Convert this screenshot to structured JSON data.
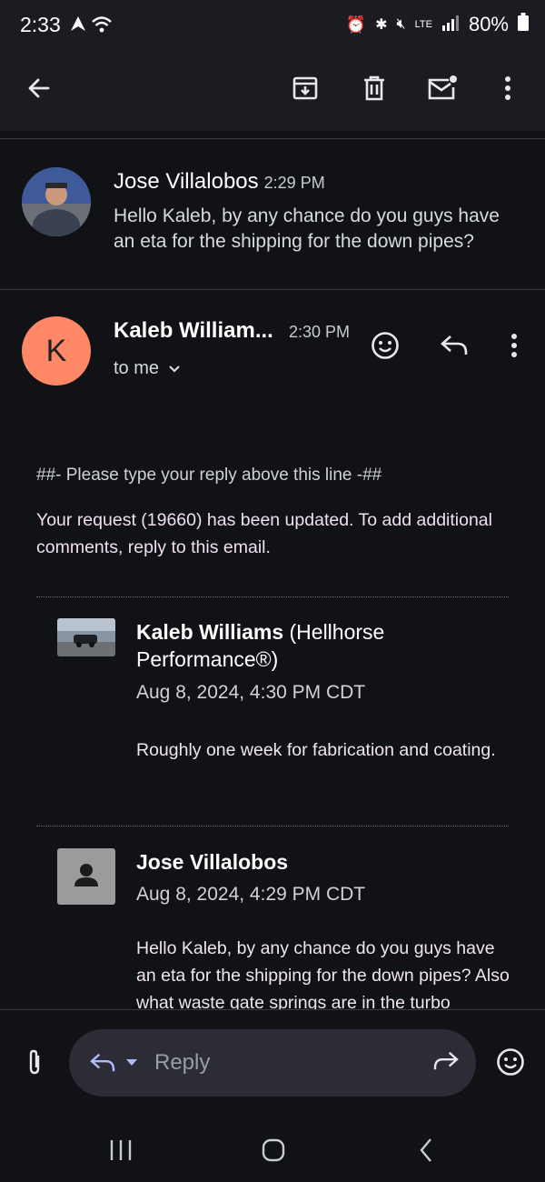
{
  "status_bar": {
    "time": "2:33",
    "battery": "80%",
    "network": "LTE"
  },
  "toolbar": {
    "back_icon": "arrow-back-icon",
    "archive_icon": "archive-icon",
    "delete_icon": "trash-icon",
    "mark_unread_icon": "mail-unread-icon",
    "more_icon": "more-vertical-icon"
  },
  "message1": {
    "sender": "Jose Villalobos",
    "time": "2:29 PM",
    "preview": "Hello Kaleb, by any chance do you guys have an eta for the shipping for the down pipes?"
  },
  "message2": {
    "avatar_letter": "K",
    "sender": "Kaleb William...",
    "time": "2:30 PM",
    "to": "to me",
    "reply_marker": "##- Please type your reply above this line -##",
    "intro": "Your request (19660) has been updated. To add additional comments, reply to this email.",
    "quotes": [
      {
        "name_bold": "Kaleb Williams",
        "name_rest": " (Hellhorse Performance®)",
        "date": "Aug 8, 2024, 4:30 PM CDT",
        "body": "Roughly one week for fabrication and coating."
      },
      {
        "name_bold": "Jose Villalobos",
        "name_rest": "",
        "date": "Aug 8, 2024, 4:29 PM CDT",
        "body": "Hello Kaleb, by any chance do you guys have an eta for the shipping for the down pipes? Also what waste gate springs are in the turbo"
      }
    ]
  },
  "reply_bar": {
    "placeholder": "Reply"
  },
  "colors": {
    "avatar_k": "#ff8866",
    "background": "#111216"
  }
}
